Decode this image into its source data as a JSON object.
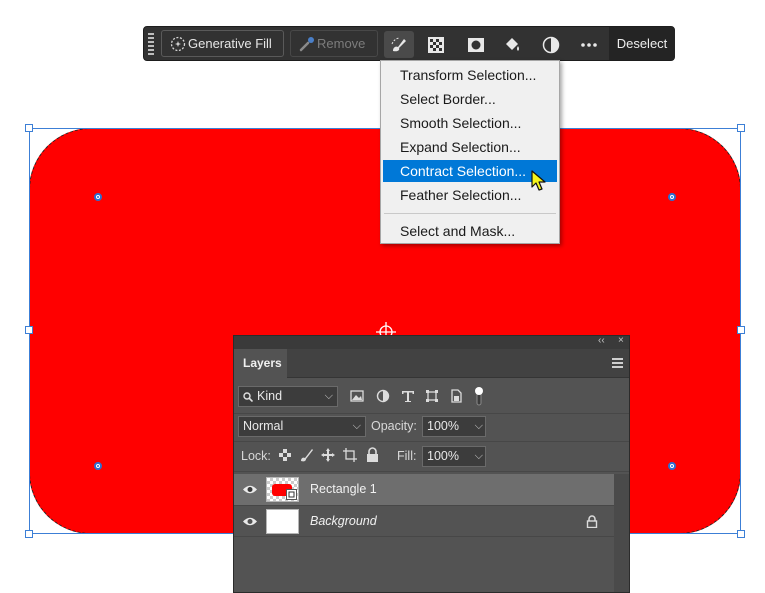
{
  "taskbar": {
    "generative_fill_label": "Generative Fill",
    "remove_label": "Remove",
    "deselect_label": "Deselect",
    "icons": [
      "modify-selection-icon",
      "mask-pattern-icon",
      "mask-icon",
      "fill-icon",
      "adjustment-icon",
      "more-icon"
    ]
  },
  "selection_menu": {
    "items": [
      {
        "label": "Transform Selection..."
      },
      {
        "label": "Select Border..."
      },
      {
        "label": "Smooth Selection..."
      },
      {
        "label": "Expand Selection..."
      },
      {
        "label": "Contract Selection...",
        "highlighted": true
      },
      {
        "label": "Feather Selection..."
      },
      {
        "label": "Select and Mask..."
      }
    ]
  },
  "layers_panel": {
    "tab_label": "Layers",
    "filter_kind": "Kind",
    "blend_mode": "Normal",
    "opacity_label": "Opacity:",
    "opacity_value": "100%",
    "lock_label": "Lock:",
    "fill_label": "Fill:",
    "fill_value": "100%",
    "layers": [
      {
        "name": "Rectangle 1",
        "selected": true,
        "visible": true
      },
      {
        "name": "Background",
        "selected": false,
        "visible": true,
        "locked": true
      }
    ]
  },
  "colors": {
    "shape_fill": "#ff0000",
    "menu_highlight": "#0078d7",
    "panel_bg": "#535353",
    "taskbar_bg": "#323232"
  }
}
